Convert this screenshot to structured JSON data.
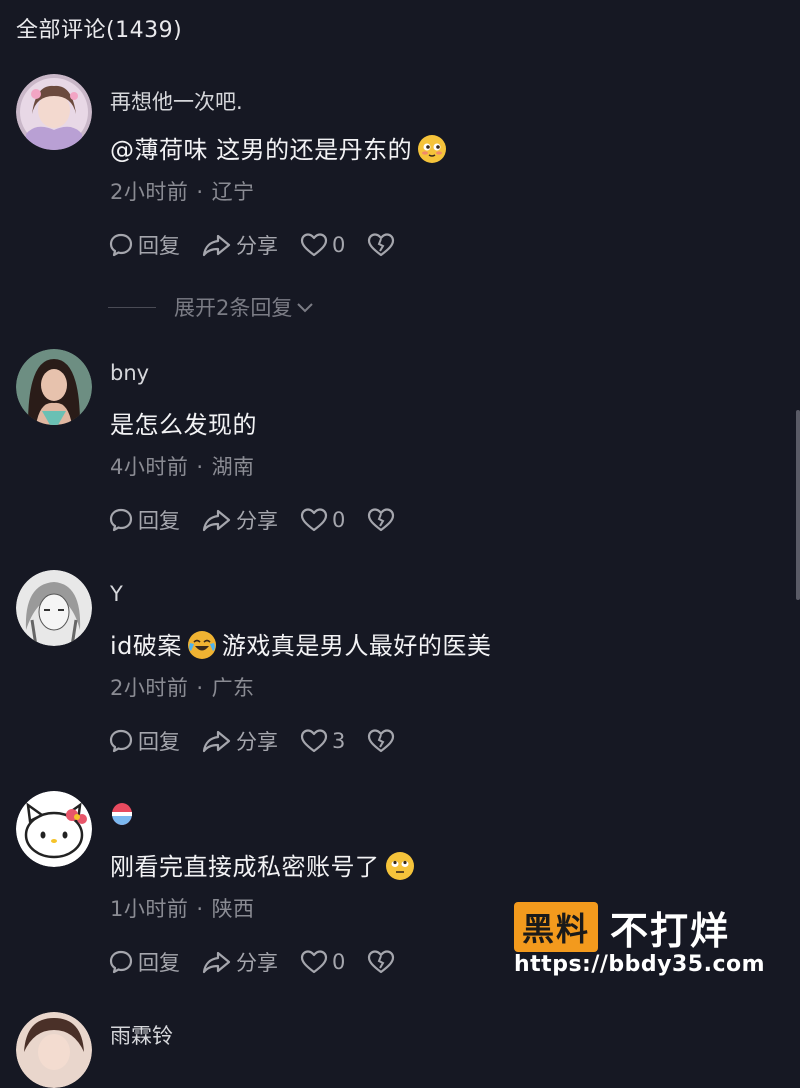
{
  "header": {
    "title": "全部评论",
    "count": "(1439)"
  },
  "comments": [
    {
      "username": "再想他一次吧.",
      "content_prefix": "@薄荷味  这男的还是丹东的",
      "emoji": "shy-face-emoji",
      "time": "2小时前",
      "location": "辽宁",
      "reply_label": "回复",
      "share_label": "分享",
      "likes": "0",
      "expand_label": "展开2条回复"
    },
    {
      "username": "bny",
      "content_prefix": "是怎么发现的",
      "time": "4小时前",
      "location": "湖南",
      "reply_label": "回复",
      "share_label": "分享",
      "likes": "0"
    },
    {
      "username": "Y",
      "content_prefix": "id破案",
      "emoji": "laugh-cry-emoji",
      "content_suffix": "游戏真是男人最好的医美",
      "time": "2小时前",
      "location": "广东",
      "reply_label": "回复",
      "share_label": "分享",
      "likes": "3"
    },
    {
      "username_emoji": "pill-emoji",
      "content_prefix": "刚看完直接成私密账号了",
      "emoji": "eye-roll-emoji",
      "time": "1小时前",
      "location": "陕西",
      "reply_label": "回复",
      "share_label": "分享",
      "likes": "0"
    },
    {
      "username": "雨霖铃"
    }
  ],
  "watermark": {
    "badge": "黑料",
    "text": "不打烊",
    "url": "https://bbdy35.com"
  },
  "colors": {
    "background": "#161823",
    "accent": "#f39a1d"
  }
}
